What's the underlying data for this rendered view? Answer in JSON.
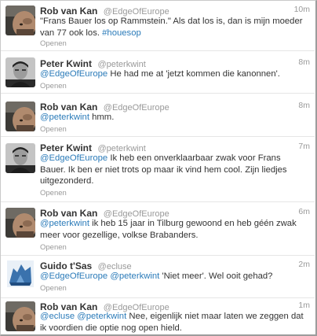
{
  "colors": {
    "link": "#2b7bb9",
    "meta": "#999999",
    "text": "#333333"
  },
  "tweets": [
    {
      "name": "Rob van Kan",
      "handle": "@EdgeOfEurope",
      "time": "10m",
      "text_parts": [
        "\"Frans Bauer los op Rammstein.\" Als dat los is, dan is mijn moeder van 77 ook los. ",
        "#houesop"
      ],
      "open": "Openen"
    },
    {
      "name": "Peter Kwint",
      "handle": "@peterkwint",
      "time": "8m",
      "text_parts": [
        "@EdgeOfEurope",
        " He had me at 'jetzt kommen die kanonnen'."
      ],
      "open": "Openen"
    },
    {
      "name": "Rob van Kan",
      "handle": "@EdgeOfEurope",
      "time": "8m",
      "text_parts": [
        "@peterkwint",
        " hmm."
      ],
      "open": "Openen"
    },
    {
      "name": "Peter Kwint",
      "handle": "@peterkwint",
      "time": "7m",
      "text_parts": [
        "@EdgeOfEurope",
        " Ik heb een onverklaarbaar zwak voor Frans Bauer. Ik ben er niet trots op maar ik vind hem cool. Zijn liedjes uitgezonderd."
      ],
      "open": "Openen"
    },
    {
      "name": "Rob van Kan",
      "handle": "@EdgeOfEurope",
      "time": "6m",
      "text_parts": [
        "@peterkwint",
        " ik heb 15 jaar in Tilburg gewoond en heb géén zwak meer voor gezellige, volkse Brabanders."
      ],
      "open": "Openen"
    },
    {
      "name": "Guido t'Sas",
      "handle": "@ecluse",
      "time": "2m",
      "text_parts": [
        "@EdgeOfEurope",
        " ",
        "@peterkwint",
        " 'Niet meer'. Wel ooit gehad?"
      ],
      "open": "Openen"
    },
    {
      "name": "Rob van Kan",
      "handle": "@EdgeOfEurope",
      "time": "1m",
      "text_parts": [
        "@ecluse",
        " ",
        "@peterkwint",
        " Nee, eigenlijk niet maar laten we zeggen dat ik voordien die optie nog open hield."
      ],
      "open": ""
    }
  ]
}
